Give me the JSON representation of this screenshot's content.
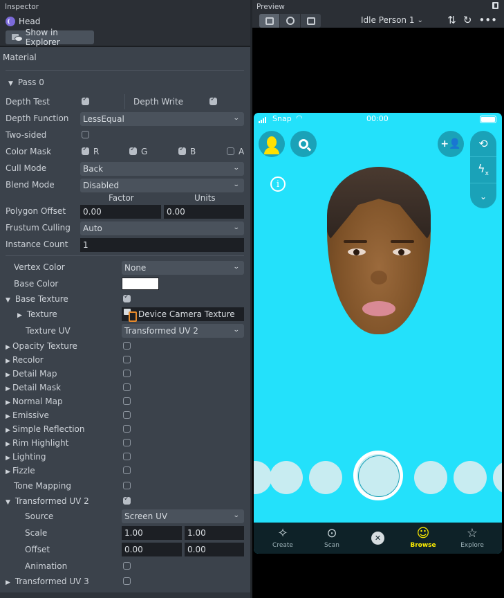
{
  "inspector": {
    "title": "Inspector",
    "object_name": "Head",
    "show_in_explorer": "Show in Explorer",
    "section": "Material",
    "pass": "Pass 0",
    "depth_test": {
      "label": "Depth Test",
      "checked": true
    },
    "depth_write": {
      "label": "Depth Write",
      "checked": true
    },
    "depth_function": {
      "label": "Depth Function",
      "value": "LessEqual"
    },
    "two_sided": {
      "label": "Two-sided",
      "checked": false
    },
    "color_mask": {
      "label": "Color Mask",
      "channels": [
        {
          "name": "R",
          "checked": true
        },
        {
          "name": "G",
          "checked": true
        },
        {
          "name": "B",
          "checked": true
        },
        {
          "name": "A",
          "checked": false
        }
      ]
    },
    "cull_mode": {
      "label": "Cull Mode",
      "value": "Back"
    },
    "blend_mode": {
      "label": "Blend Mode",
      "value": "Disabled"
    },
    "polygon_offset": {
      "label": "Polygon Offset",
      "factor_header": "Factor",
      "units_header": "Units",
      "factor": "0.00",
      "units": "0.00"
    },
    "frustum_culling": {
      "label": "Frustum Culling",
      "value": "Auto"
    },
    "instance_count": {
      "label": "Instance Count",
      "value": "1"
    },
    "vertex_color": {
      "label": "Vertex Color",
      "value": "None"
    },
    "base_color": {
      "label": "Base Color",
      "color": "#ffffff"
    },
    "base_texture": {
      "label": "Base Texture",
      "checked": true
    },
    "texture": {
      "label": "Texture",
      "value": "Device Camera Texture"
    },
    "texture_uv": {
      "label": "Texture UV",
      "value": "Transformed UV 2"
    },
    "toggles": [
      {
        "label": "Opacity Texture",
        "checked": false,
        "expandable": true
      },
      {
        "label": "Recolor",
        "checked": false,
        "expandable": true
      },
      {
        "label": "Detail Map",
        "checked": false,
        "expandable": true
      },
      {
        "label": "Detail Mask",
        "checked": false,
        "expandable": true
      },
      {
        "label": "Normal Map",
        "checked": false,
        "expandable": true
      },
      {
        "label": "Emissive",
        "checked": false,
        "expandable": true
      },
      {
        "label": "Simple Reflection",
        "checked": false,
        "expandable": true
      },
      {
        "label": "Rim Highlight",
        "checked": false,
        "expandable": true
      },
      {
        "label": "Lighting",
        "checked": false,
        "expandable": true
      },
      {
        "label": "Fizzle",
        "checked": false,
        "expandable": true
      },
      {
        "label": "Tone Mapping",
        "checked": false,
        "expandable": false
      }
    ],
    "transformed_uv2": {
      "label": "Transformed UV 2",
      "checked": true,
      "source": {
        "label": "Source",
        "value": "Screen UV"
      },
      "scale": {
        "label": "Scale",
        "x": "1.00",
        "y": "1.00"
      },
      "offset": {
        "label": "Offset",
        "x": "0.00",
        "y": "0.00"
      },
      "animation": {
        "label": "Animation",
        "checked": false
      }
    },
    "transformed_uv3": {
      "label": "Transformed UV 3",
      "checked": false
    }
  },
  "preview": {
    "title": "Preview",
    "person_select": "Idle Person 1",
    "phone": {
      "carrier": "Snap",
      "clock": "00:00",
      "nav": [
        {
          "label": "Create",
          "icon": "magic-wand-icon",
          "active": false
        },
        {
          "label": "Scan",
          "icon": "scan-icon",
          "active": false
        },
        {
          "label": "Browse",
          "icon": "smiley-icon",
          "active": true
        },
        {
          "label": "Explore",
          "icon": "explore-icon",
          "active": false
        }
      ],
      "accent_color": "#23e1fb",
      "active_nav_color": "#ffee00"
    }
  }
}
